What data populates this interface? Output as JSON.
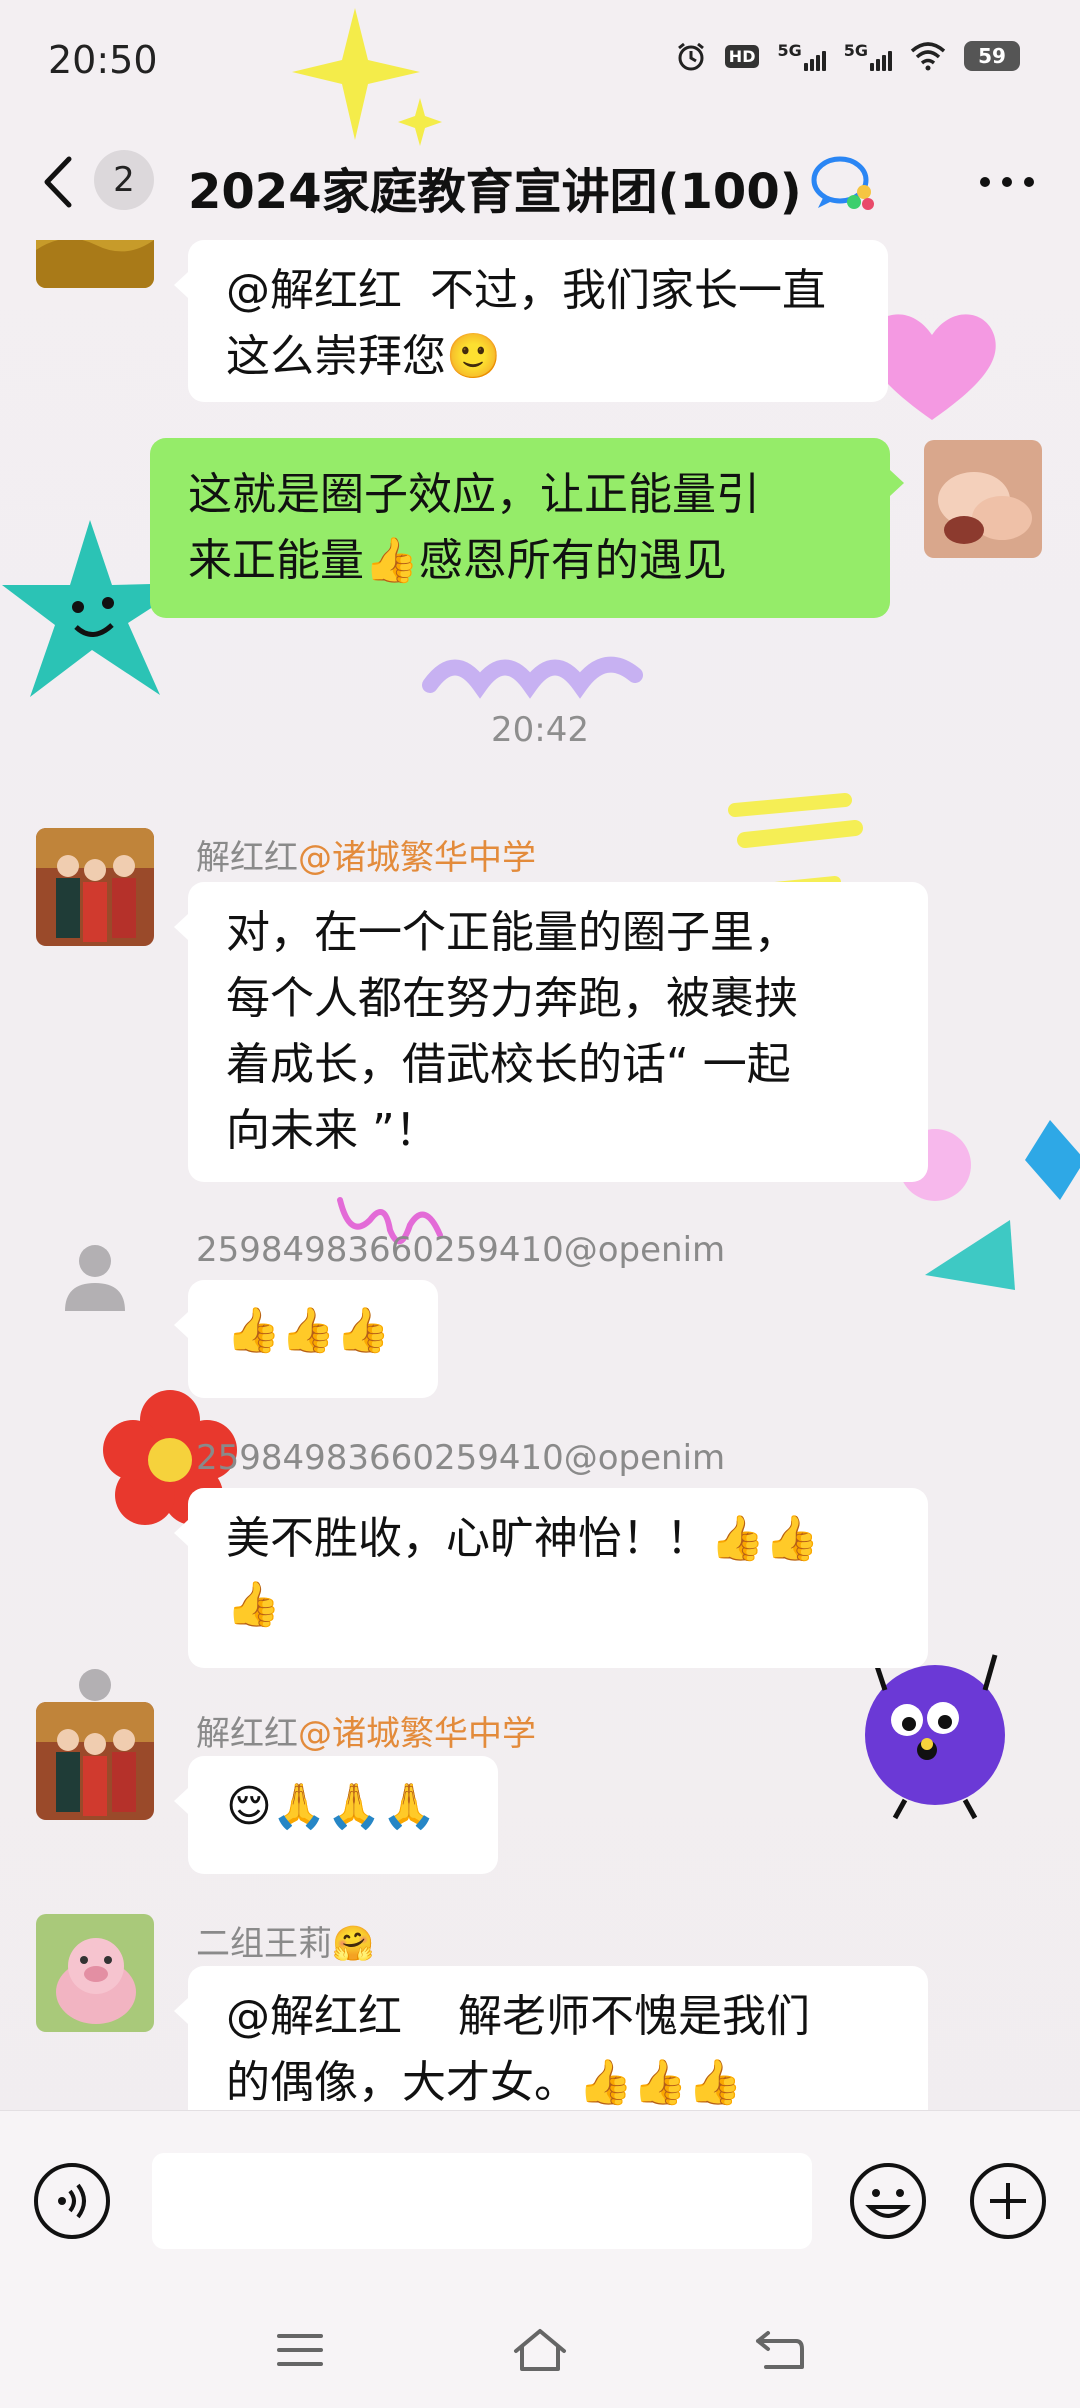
{
  "status_bar": {
    "time": "20:50",
    "hd_label": "HD",
    "network_1": "5G",
    "network_2": "5G",
    "battery": "59"
  },
  "header": {
    "unread_count": "2",
    "title": "2024家庭教育宣讲团(100)"
  },
  "messages": {
    "m1": {
      "text": "@解红红  不过，我们家长一直\n这么崇拜您🙂"
    },
    "m2": {
      "text": "这就是圈子效应，让正能量引\n来正能量👍感恩所有的遇见"
    },
    "time_divider": "20:42",
    "m3": {
      "sender": "解红红",
      "org": "@诸城繁华中学",
      "text": "对，在一个正能量的圈子里，\n每个人都在努力奔跑，被裹挟\n着成长，借武校长的话“ 一起\n向未来 ”！"
    },
    "m4": {
      "sender": "2598498366025941​0@openim",
      "text": "👍👍👍"
    },
    "m5": {
      "sender": "2598498366025941​0@openim",
      "text": "美不胜收，心旷神怡！！👍👍\n👍"
    },
    "m6": {
      "sender": "解红红",
      "org": "@诸城繁华中学",
      "text": "😌🙏🙏🙏"
    },
    "m7": {
      "sender": "二组王莉🤗",
      "text": "@解红红    解老师不愧是我们\n的偶像，大才女。👍👍👍"
    }
  },
  "input_bar": {
    "placeholder": ""
  },
  "colors": {
    "outgoing_bubble": "#95ec69",
    "incoming_bubble": "#ffffff",
    "org_tag": "#e38b3b"
  }
}
